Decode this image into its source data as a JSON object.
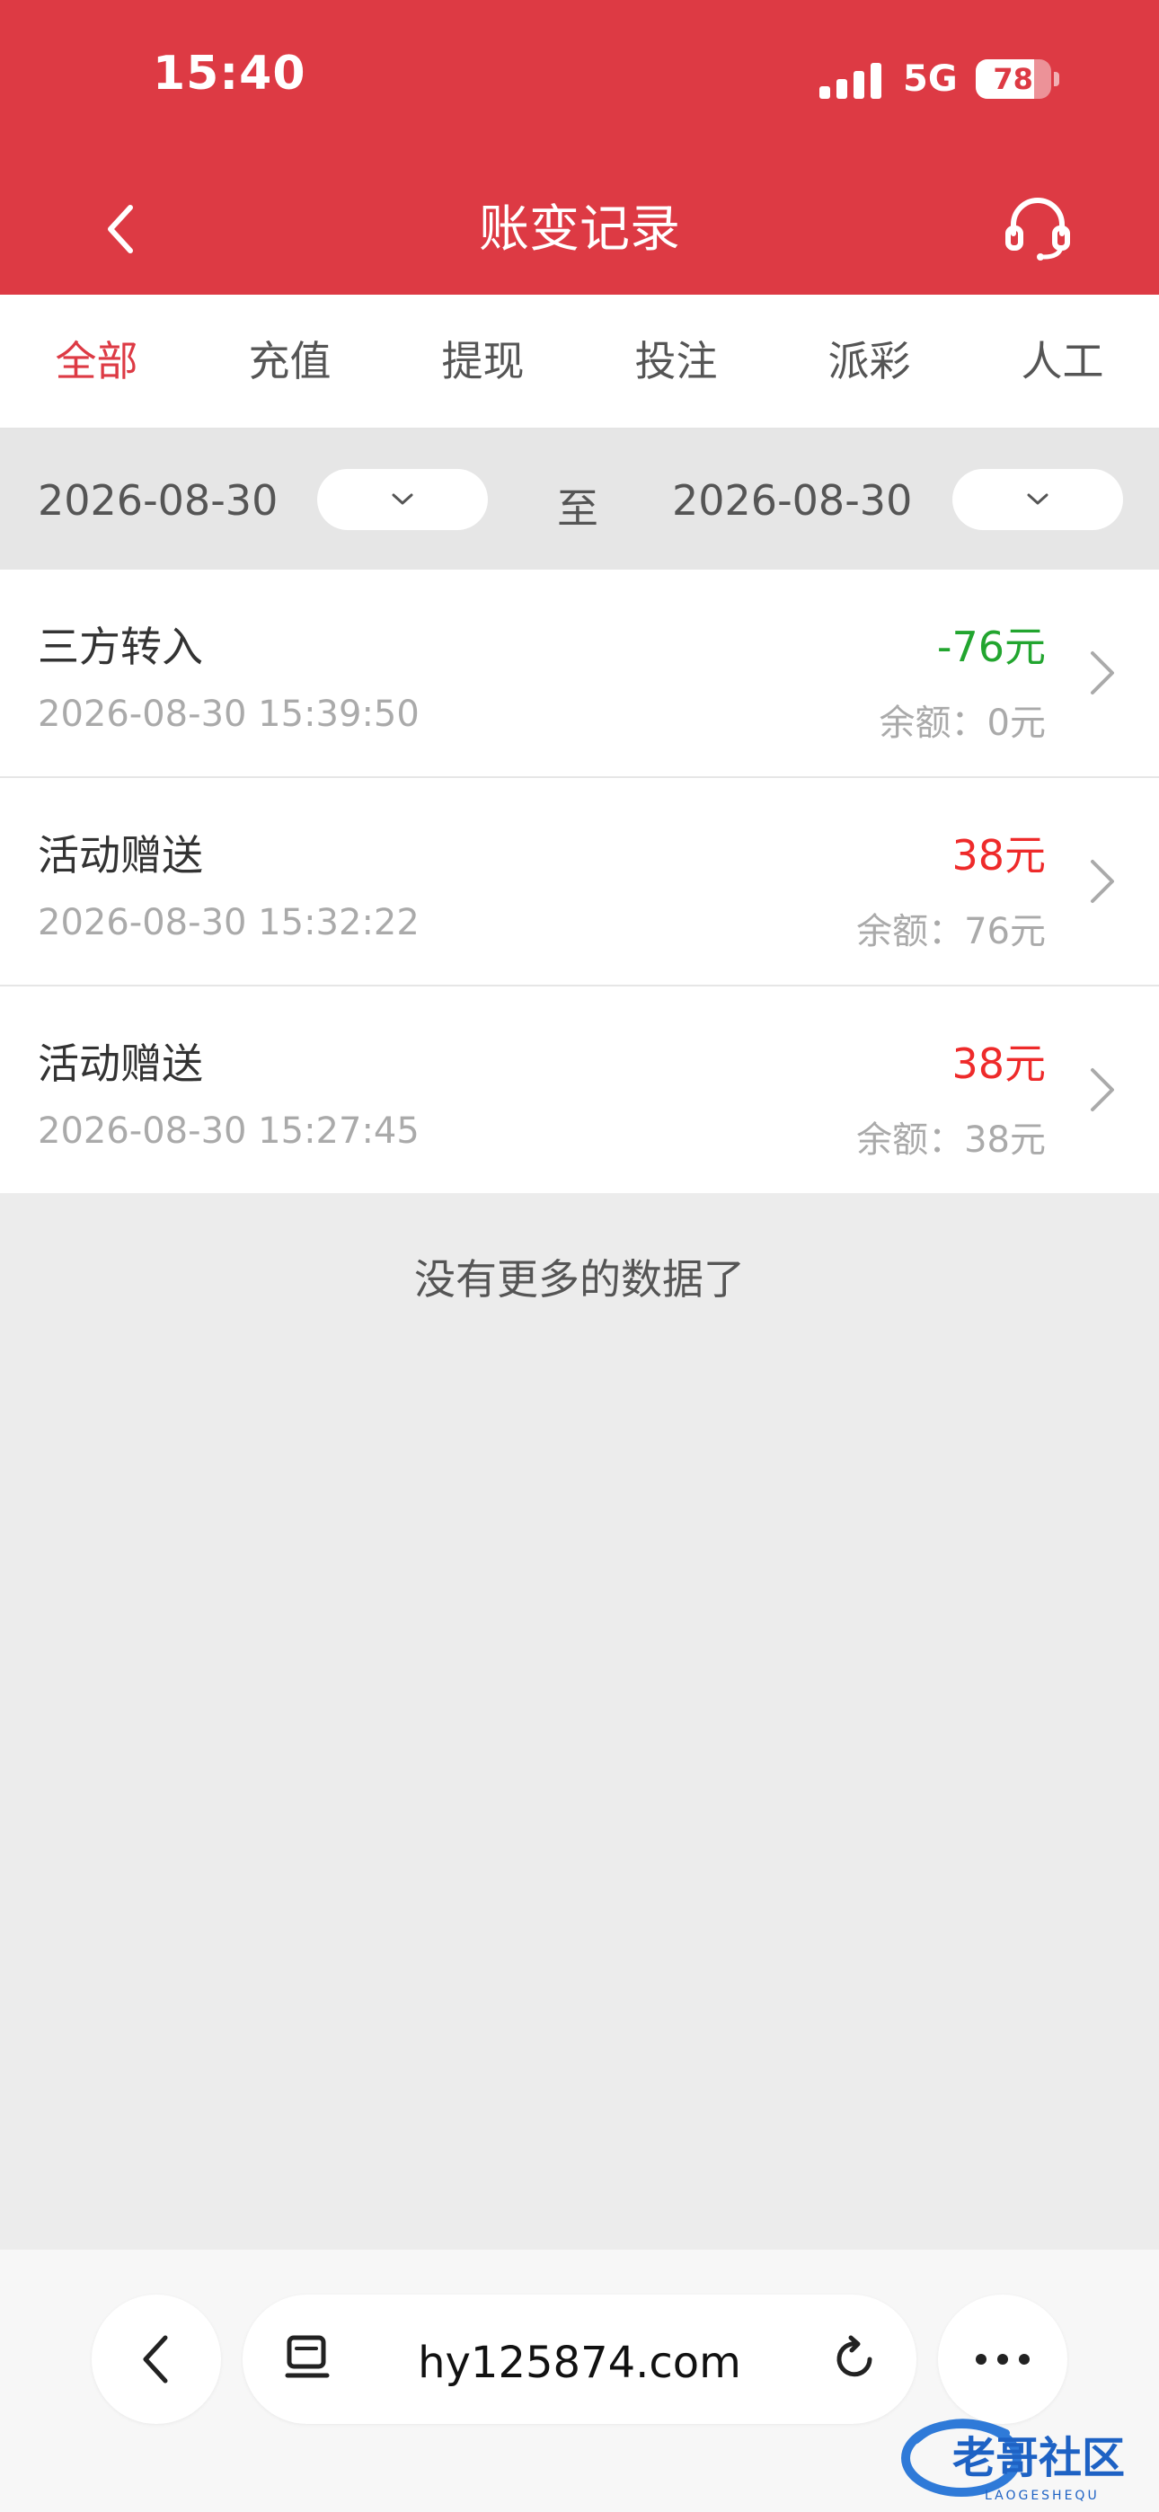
{
  "status_bar": {
    "time": "15:40",
    "network": "5G",
    "battery": "78",
    "battery_level": 0.78
  },
  "header": {
    "title": "账变记录"
  },
  "tabs": [
    {
      "label": "全部",
      "active": true
    },
    {
      "label": "充值",
      "active": false
    },
    {
      "label": "提现",
      "active": false
    },
    {
      "label": "投注",
      "active": false
    },
    {
      "label": "派彩",
      "active": false
    },
    {
      "label": "人工",
      "active": false
    }
  ],
  "filter": {
    "start_date": "2026-08-30",
    "to_label": "至",
    "end_date": "2026-08-30"
  },
  "records": [
    {
      "type": "三方转入",
      "time": "2026-08-30 15:39:50",
      "amount": "-76元",
      "balance": "余额：0元",
      "amount_color": "#22a52f"
    },
    {
      "type": "活动赠送",
      "time": "2026-08-30 15:32:22",
      "amount": "38元",
      "balance": "余额：76元",
      "amount_color": "#ee2a2a"
    },
    {
      "type": "活动赠送",
      "time": "2026-08-30 15:27:45",
      "amount": "38元",
      "balance": "余额：38元",
      "amount_color": "#ee2a2a"
    }
  ],
  "no_more_text": "没有更多的数据了",
  "browser": {
    "url": "hy125874.com"
  },
  "watermark": {
    "text": "老哥社区",
    "subtext": "LAOGESHEQU"
  },
  "colors": {
    "brand_red": "#dd3a44",
    "page_bg": "#ececec"
  }
}
